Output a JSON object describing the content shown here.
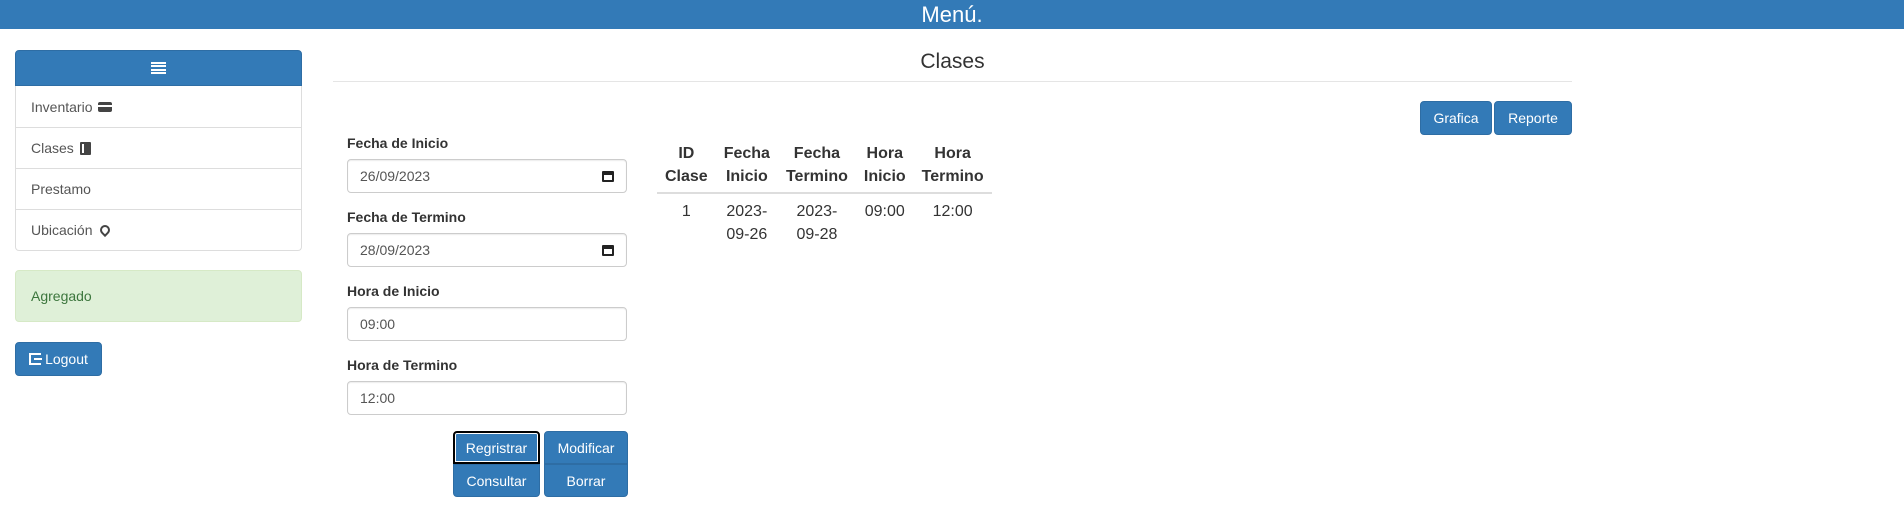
{
  "topbar": {
    "title": "Menú."
  },
  "sidebar": {
    "header_icon": "menu-hamburger-icon",
    "items": [
      {
        "label": "Inventario",
        "icon": "credit-card-icon"
      },
      {
        "label": "Clases",
        "icon": "book-icon"
      },
      {
        "label": "Prestamo",
        "icon": ""
      },
      {
        "label": "Ubicación",
        "icon": "map-pin-icon"
      }
    ],
    "alert": "Agregado",
    "logout_label": "Logout"
  },
  "main": {
    "title": "Clases",
    "buttons": {
      "grafica": "Grafica",
      "reporte": "Reporte"
    },
    "form": {
      "fecha_inicio_label": "Fecha de Inicio",
      "fecha_inicio_value": "26/09/2023",
      "fecha_termino_label": "Fecha de Termino",
      "fecha_termino_value": "28/09/2023",
      "hora_inicio_label": "Hora de Inicio",
      "hora_inicio_value": "09:00",
      "hora_termino_label": "Hora de Termino",
      "hora_termino_value": "12:00",
      "registrar": "Regristrar",
      "modificar": "Modificar",
      "consultar": "Consultar",
      "borrar": "Borrar"
    },
    "table": {
      "headers": [
        [
          "ID",
          "Clase"
        ],
        [
          "Fecha",
          "Inicio"
        ],
        [
          "Fecha",
          "Termino"
        ],
        [
          "Hora",
          "Inicio"
        ],
        [
          "Hora",
          "Termino"
        ]
      ],
      "rows": [
        [
          [
            "1"
          ],
          [
            "2023-",
            "09-26"
          ],
          [
            "2023-",
            "09-28"
          ],
          [
            "09:00"
          ],
          [
            "12:00"
          ]
        ]
      ]
    }
  },
  "colors": {
    "primary": "#337ab7",
    "success_bg": "#dff0d8",
    "success_text": "#3c763d"
  }
}
